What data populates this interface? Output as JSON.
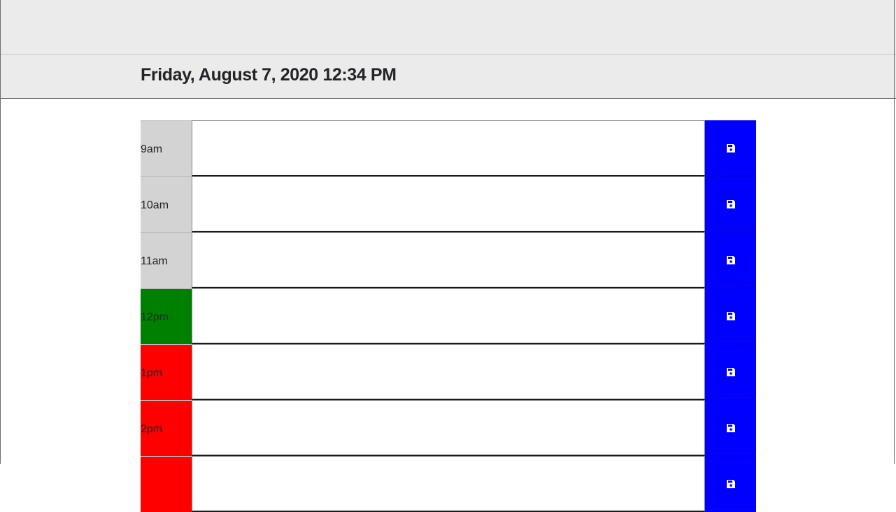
{
  "header": {
    "current_day": "Friday, August 7, 2020 12:34 PM"
  },
  "colors": {
    "past": "#d3d3d3",
    "present": "#008000",
    "future": "#ff0000",
    "save_button": "#0000ff",
    "header_bg": "#ebebeb"
  },
  "time_blocks": [
    {
      "hour": "9am",
      "state": "past",
      "description": "",
      "save_icon": "save-icon"
    },
    {
      "hour": "10am",
      "state": "past",
      "description": "",
      "save_icon": "save-icon"
    },
    {
      "hour": "11am",
      "state": "past",
      "description": "",
      "save_icon": "save-icon"
    },
    {
      "hour": "12pm",
      "state": "present",
      "description": "",
      "save_icon": "save-icon"
    },
    {
      "hour": "1pm",
      "state": "future",
      "description": "",
      "save_icon": "save-icon"
    },
    {
      "hour": "2pm",
      "state": "future",
      "description": "",
      "save_icon": "save-icon"
    },
    {
      "hour": "",
      "state": "future",
      "description": "",
      "save_icon": "save-icon"
    }
  ]
}
